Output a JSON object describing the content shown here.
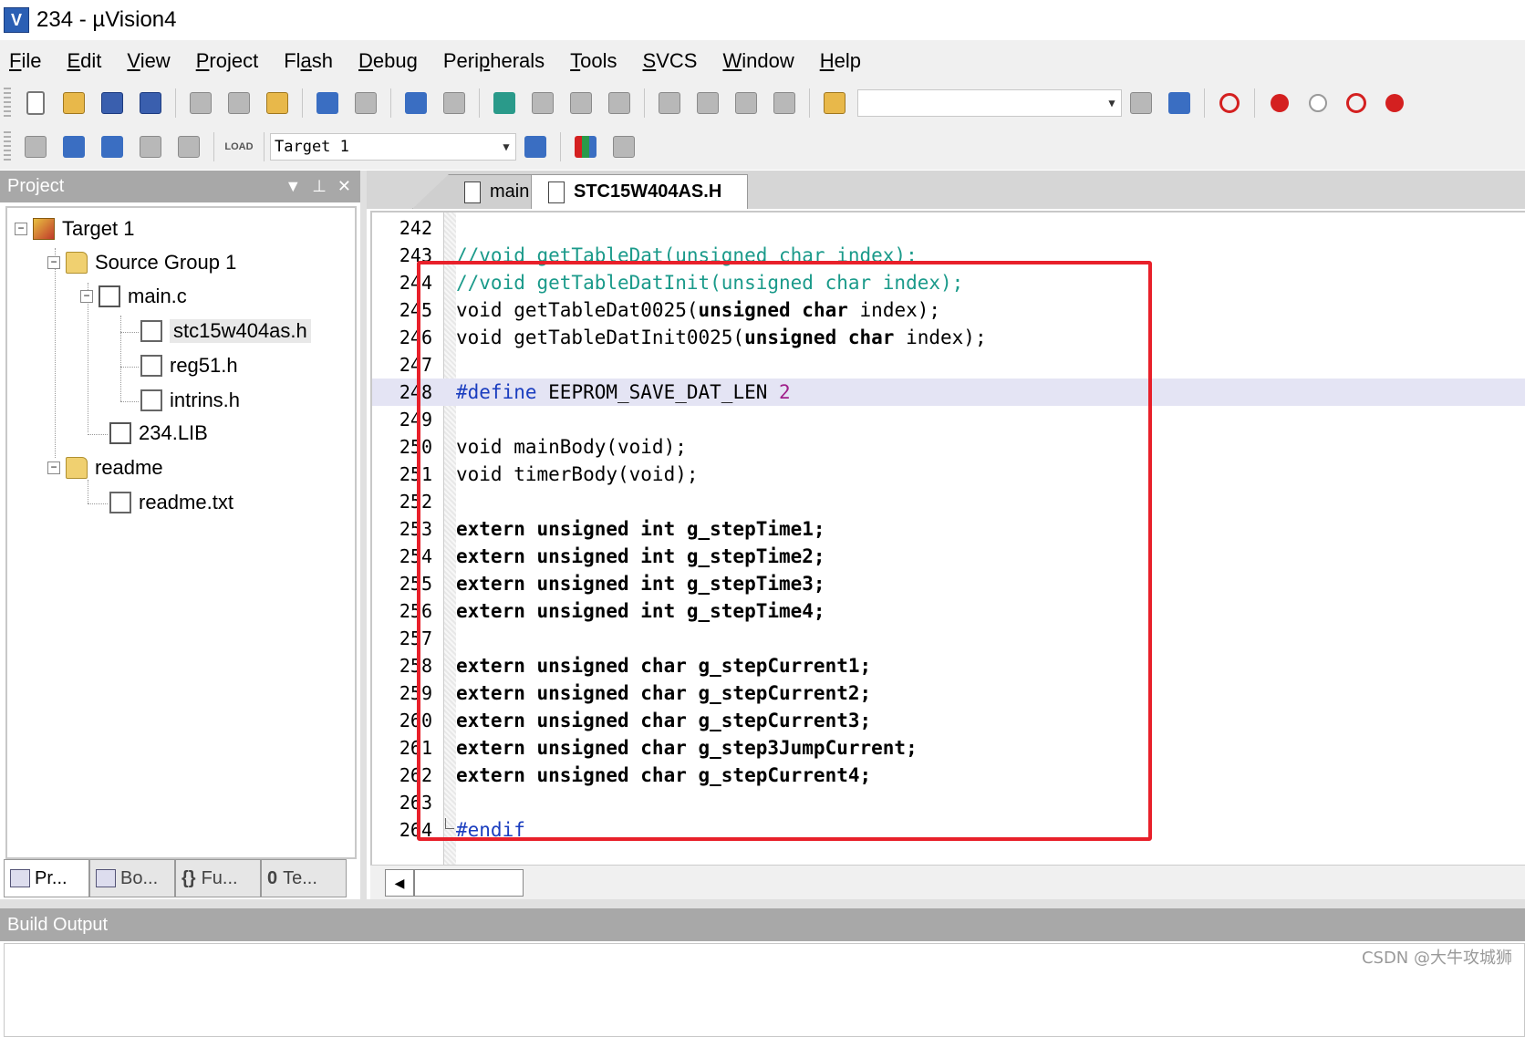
{
  "window": {
    "title": "234  - µVision4",
    "icon": "uvision-app-icon"
  },
  "menu": [
    {
      "label": "File",
      "ul": "F",
      "rest": "ile"
    },
    {
      "label": "Edit",
      "ul": "E",
      "rest": "dit"
    },
    {
      "label": "View",
      "ul": "V",
      "rest": "iew"
    },
    {
      "label": "Project",
      "ul": "P",
      "rest": "roject"
    },
    {
      "label": "Flash",
      "pre": "Fl",
      "ul": "a",
      "rest": "sh"
    },
    {
      "label": "Debug",
      "ul": "D",
      "rest": "ebug"
    },
    {
      "label": "Peripherals",
      "pre": "Peri",
      "ul": "p",
      "rest": "herals"
    },
    {
      "label": "Tools",
      "ul": "T",
      "rest": "ools"
    },
    {
      "label": "SVCS",
      "ul": "S",
      "rest": "VCS"
    },
    {
      "label": "Window",
      "ul": "W",
      "rest": "indow"
    },
    {
      "label": "Help",
      "ul": "H",
      "rest": "elp"
    }
  ],
  "toolbar2": {
    "target_combo": "Target 1",
    "load_label": "LOAD"
  },
  "project_panel": {
    "title": "Project",
    "tree": {
      "target": "Target 1",
      "group": "Source Group 1",
      "main_file": "main.c",
      "headers": [
        "stc15w404as.h",
        "reg51.h",
        "intrins.h"
      ],
      "lib": "234.LIB",
      "readme_group": "readme",
      "readme_file": "readme.txt"
    },
    "tabs": [
      "Pr...",
      "Bo...",
      "Fu...",
      "Te..."
    ]
  },
  "editor": {
    "tabs": [
      "main.c",
      "STC15W404AS.H"
    ],
    "active_tab": "STC15W404AS.H",
    "line_numbers": [
      "242",
      "243",
      "244",
      "245",
      "246",
      "247",
      "248",
      "249",
      "250",
      "251",
      "252",
      "253",
      "254",
      "255",
      "256",
      "257",
      "258",
      "259",
      "260",
      "261",
      "262",
      "263",
      "264"
    ],
    "lines": {
      "l243": "//void getTableDat(unsigned char index);",
      "l244": "//void getTableDatInit(unsigned char index);",
      "l245_a": "void getTableDat0025(",
      "l245_b": "unsigned char",
      "l245_c": " index);",
      "l246_a": "void getTableDatInit0025(",
      "l246_b": "unsigned char",
      "l246_c": " index);",
      "l248_a": "#define",
      "l248_b": " EEPROM_SAVE_DAT_LEN ",
      "l248_c": "2",
      "l250": "void mainBody(void);",
      "l251": "void timerBody(void);",
      "l253": "extern unsigned int g_stepTime1;",
      "l254": "extern unsigned int g_stepTime2;",
      "l255": "extern unsigned int g_stepTime3;",
      "l256": "extern unsigned int g_stepTime4;",
      "l258": "extern unsigned char g_stepCurrent1;",
      "l259": "extern unsigned char g_stepCurrent2;",
      "l260": "extern unsigned char g_stepCurrent3;",
      "l261": "extern unsigned char g_step3JumpCurrent;",
      "l262": "extern unsigned char g_stepCurrent4;",
      "l264": "#endif"
    },
    "colors": {
      "comment": "#1a9a8a",
      "preprocessor": "#1a3dbf",
      "number": "#a0208a",
      "highlight": "#e4e4f4",
      "annotation_box": "#e8202a"
    }
  },
  "build_output": {
    "title": "Build Output"
  },
  "watermark": "CSDN @大牛攻城狮"
}
